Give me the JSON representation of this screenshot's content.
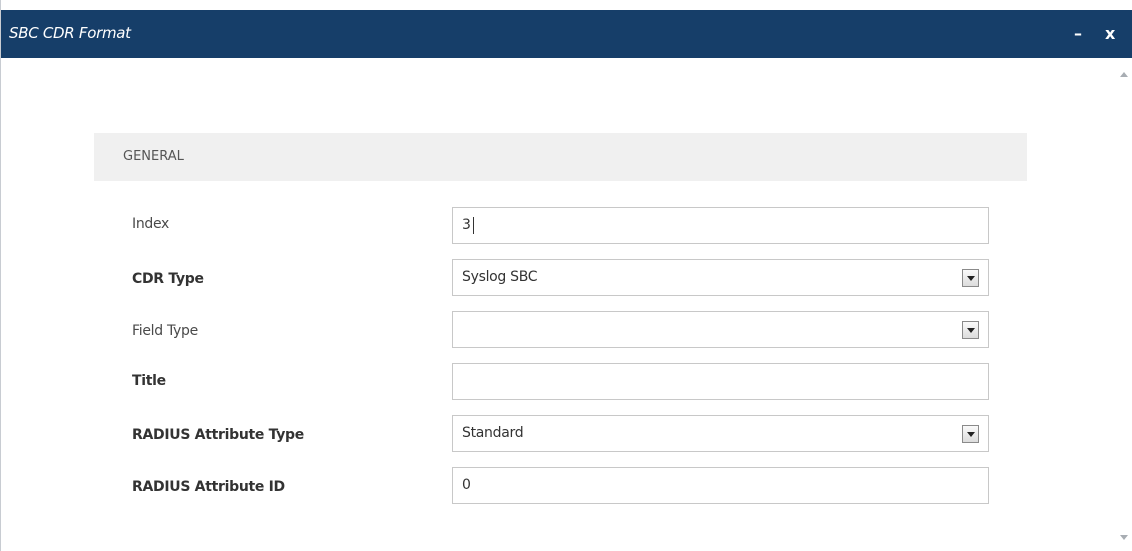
{
  "window": {
    "title": "SBC CDR Format",
    "minimize_label": "–",
    "close_label": "x"
  },
  "section": {
    "title": "GENERAL"
  },
  "fields": {
    "index": {
      "label": "Index",
      "value": "3"
    },
    "cdr_type": {
      "label": "CDR Type",
      "value": "Syslog SBC"
    },
    "field_type": {
      "label": "Field Type",
      "value": ""
    },
    "title": {
      "label": "Title",
      "value": ""
    },
    "radius_attribute_type": {
      "label": "RADIUS Attribute Type",
      "value": "Standard"
    },
    "radius_attribute_id": {
      "label": "RADIUS Attribute ID",
      "value": "0"
    }
  },
  "icons": {
    "dropdown": "chevron-down-icon",
    "scroll_up": "scroll-up-icon",
    "scroll_down": "scroll-down-icon"
  }
}
